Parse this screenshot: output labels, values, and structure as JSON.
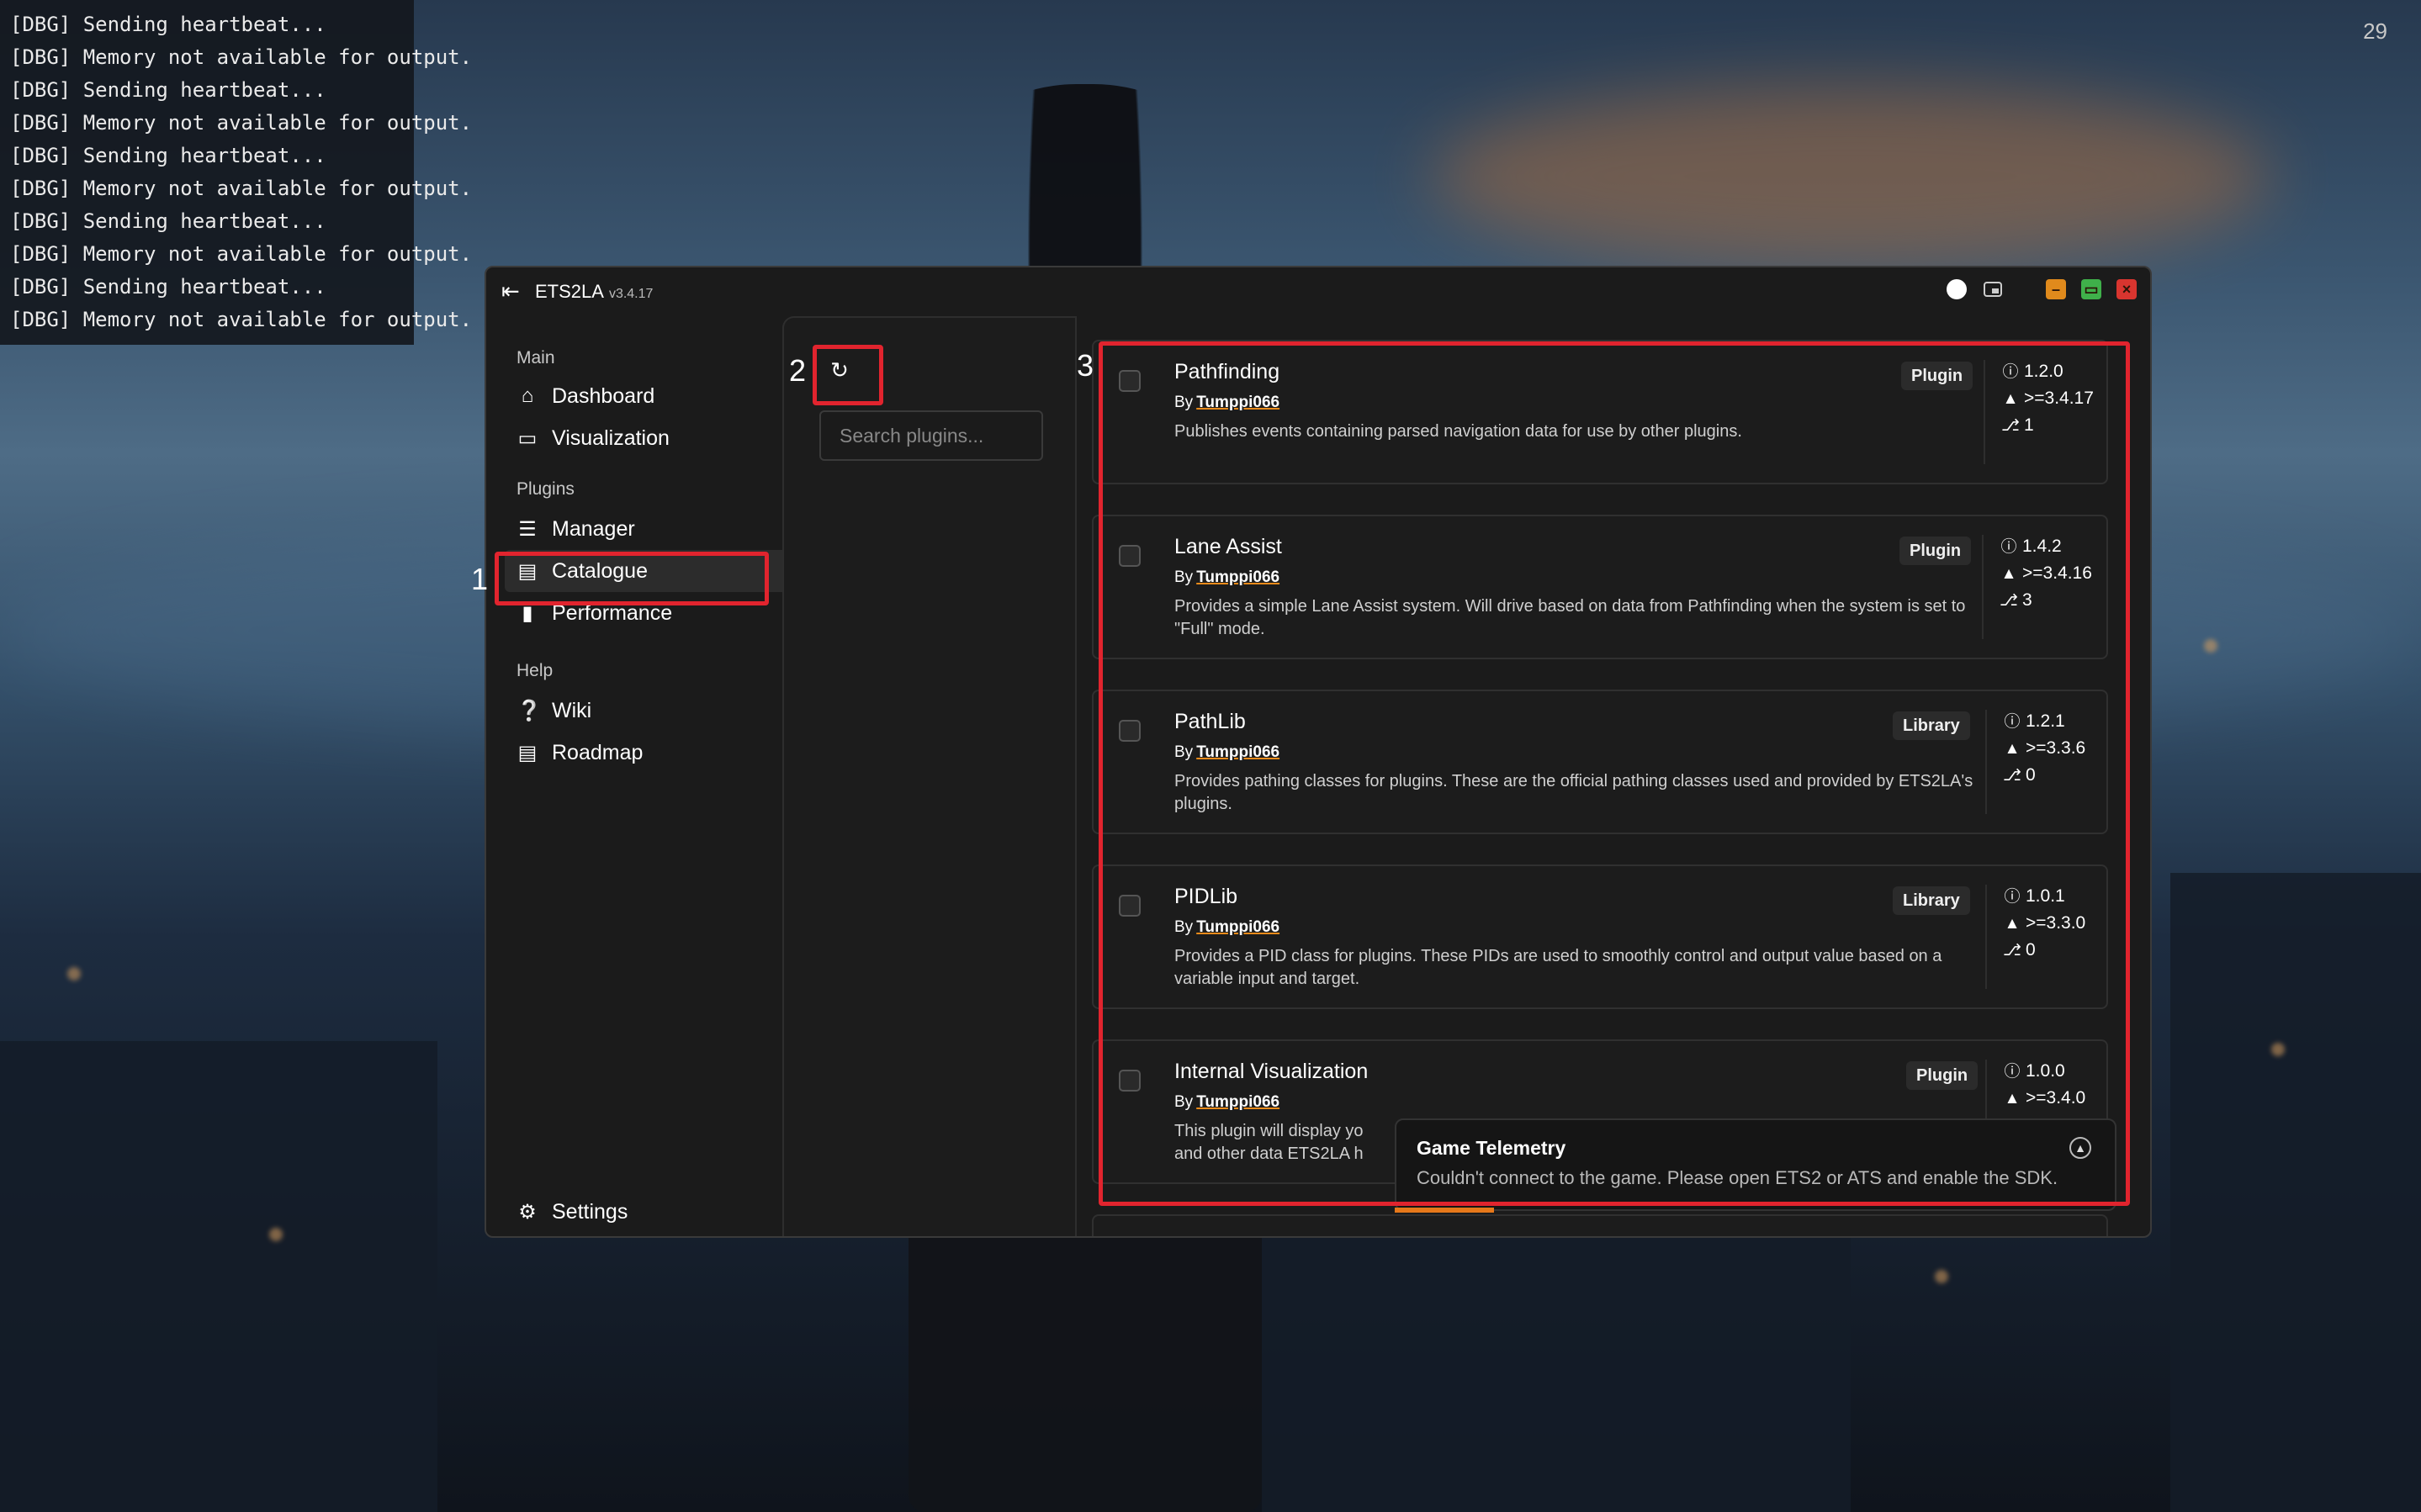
{
  "debug_console": {
    "lines": [
      "[DBG]  Sending heartbeat...",
      "[DBG]  Memory not available for output.",
      "[DBG]  Sending heartbeat...",
      "[DBG]  Memory not available for output.",
      "[DBG]  Sending heartbeat...",
      "[DBG]  Memory not available for output.",
      "[DBG]  Sending heartbeat...",
      "[DBG]  Memory not available for output.",
      "[DBG]  Sending heartbeat...",
      "[DBG]  Memory not available for output."
    ]
  },
  "corner_number": "29",
  "window": {
    "title": "ETS2LA",
    "version": "v3.4.17",
    "colors": {
      "minimize": "#e08a1c",
      "maximize": "#3fb04a",
      "close": "#d9352f"
    }
  },
  "sidebar": {
    "sections": {
      "main": "Main",
      "plugins": "Plugins",
      "help": "Help"
    },
    "items": [
      {
        "label": "Dashboard",
        "icon": "home-icon"
      },
      {
        "label": "Visualization",
        "icon": "monitor-icon"
      },
      {
        "label": "Manager",
        "icon": "list-icon"
      },
      {
        "label": "Catalogue",
        "icon": "store-icon",
        "active": true
      },
      {
        "label": "Performance",
        "icon": "bar-chart-icon"
      },
      {
        "label": "Wiki",
        "icon": "help-circle-icon"
      },
      {
        "label": "Roadmap",
        "icon": "roadmap-icon"
      }
    ],
    "settings": "Settings"
  },
  "annotations": {
    "one": "1",
    "two": "2",
    "three": "3",
    "highlight_color": "#e1242e"
  },
  "search": {
    "placeholder": "Search plugins..."
  },
  "plugins": [
    {
      "name": "Pathfinding",
      "by": "By",
      "author": "Tumppi066",
      "type": "Plugin",
      "description": "Publishes events containing parsed navigation data for use by other plugins.",
      "version": "1.2.0",
      "requires": ">=3.4.17",
      "dependents": "1"
    },
    {
      "name": "Lane Assist",
      "by": "By",
      "author": "Tumppi066",
      "type": "Plugin",
      "description": "Provides a simple Lane Assist system. Will drive based on data from Pathfinding when the system is set to \"Full\" mode.",
      "version": "1.4.2",
      "requires": ">=3.4.16",
      "dependents": "3"
    },
    {
      "name": "PathLib",
      "by": "By",
      "author": "Tumppi066",
      "type": "Library",
      "description": "Provides pathing classes for plugins. These are the official pathing classes used and provided by ETS2LA's plugins.",
      "version": "1.2.1",
      "requires": ">=3.3.6",
      "dependents": "0"
    },
    {
      "name": "PIDLib",
      "by": "By",
      "author": "Tumppi066",
      "type": "Library",
      "description": "Provides a PID class for plugins. These PIDs are used to smoothly control and output value based on a variable input and target.",
      "version": "1.0.1",
      "requires": ">=3.3.0",
      "dependents": "0"
    },
    {
      "name": "Internal Visualization",
      "by": "By",
      "author": "Tumppi066",
      "type": "Plugin",
      "description": "This plugin will display yo and other data ETS2LA h",
      "version": "1.0.0",
      "requires": ">=3.4.0",
      "dependents": ""
    }
  ],
  "toast": {
    "title": "Game Telemetry",
    "message": "Couldn't connect to the game. Please open ETS2 or ATS and enable the SDK.",
    "progress_color": "#e6781a"
  }
}
